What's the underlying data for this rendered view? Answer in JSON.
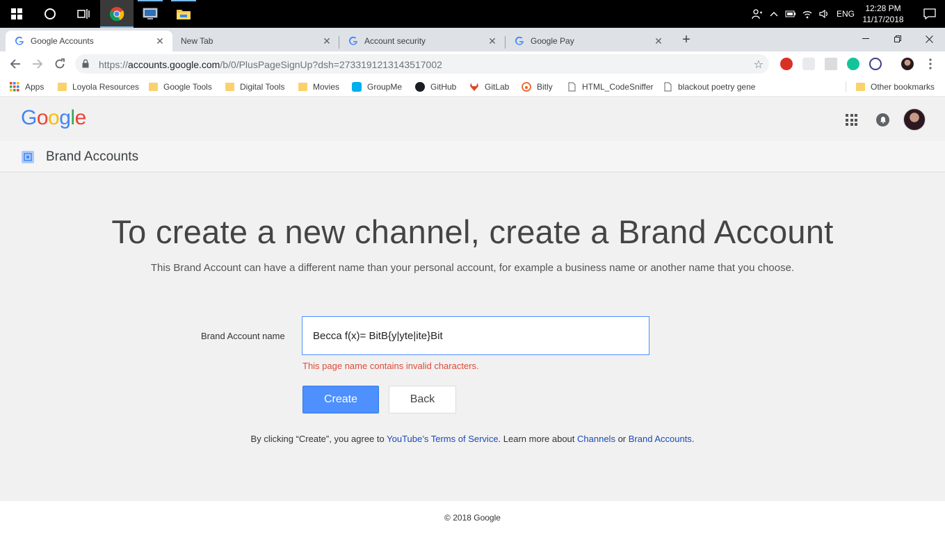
{
  "taskbar": {
    "time": "12:28 PM",
    "date": "11/17/2018",
    "language": "ENG"
  },
  "tabs": [
    {
      "title": "Google Accounts",
      "active": true,
      "favicon": "google-g-icon"
    },
    {
      "title": "New Tab",
      "active": false,
      "favicon": "none"
    },
    {
      "title": "Account security",
      "active": false,
      "favicon": "google-g-icon"
    },
    {
      "title": "Google Pay",
      "active": false,
      "favicon": "google-g-icon"
    }
  ],
  "omnibox": {
    "url_scheme": "https://",
    "url_host": "accounts.google.com",
    "url_path": "/b/0/PlusPageSignUp?dsh=2733191213143517002"
  },
  "bookmarks": {
    "items": [
      "Apps",
      "Loyola Resources",
      "Google Tools",
      "Digital Tools",
      "Movies",
      "GroupMe",
      "GitHub",
      "GitLab",
      "Bitly",
      "HTML_CodeSniffer",
      "blackout poetry gene"
    ],
    "other": "Other bookmarks"
  },
  "header": {
    "logo": "Google",
    "section_title": "Brand Accounts"
  },
  "main": {
    "headline": "To create a new channel, create a Brand Account",
    "subline": "This Brand Account can have a different name than your personal account, for example a business name or another name that you choose.",
    "field_label": "Brand Account name",
    "field_value": "Becca f(x)= BitB{y|yte|ite}Bit",
    "error": "This page name contains invalid characters.",
    "create_label": "Create",
    "back_label": "Back",
    "terms_prefix": "By clicking “Create”, you agree to ",
    "terms_link": "YouTube’s Terms of Service",
    "terms_middle": ". Learn more about ",
    "channels_link": "Channels",
    "terms_or": " or ",
    "brand_link": "Brand Accounts",
    "terms_end": "."
  },
  "footer": {
    "copyright": "© 2018 Google"
  },
  "colors": {
    "google_blue": "#4285f4",
    "google_red": "#ea4335",
    "google_yellow": "#fbbc05",
    "google_green": "#34a853",
    "button_blue": "#4d90fe",
    "error_red": "#dd4b39",
    "link_blue": "#1a4ab8"
  }
}
